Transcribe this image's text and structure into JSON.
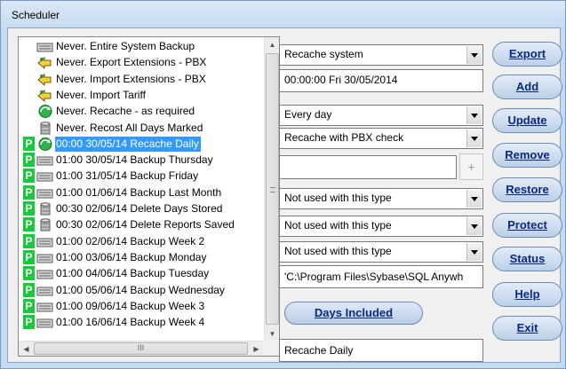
{
  "window": {
    "title": "Scheduler"
  },
  "list": {
    "items": [
      {
        "icon": "keyboard-icon",
        "p": false,
        "text": "Never.  Entire System Backup"
      },
      {
        "icon": "arrows-icon",
        "p": false,
        "text": "Never.  Export Extensions - PBX"
      },
      {
        "icon": "arrows-icon",
        "p": false,
        "text": "Never.  Import Extensions - PBX"
      },
      {
        "icon": "arrows-icon",
        "p": false,
        "text": "Never.  Import Tariff"
      },
      {
        "icon": "refresh-icon",
        "p": false,
        "text": "Never.  Recache - as required"
      },
      {
        "icon": "database-icon",
        "p": false,
        "text": "Never.  Recost All Days Marked"
      },
      {
        "icon": "refresh-icon",
        "p": true,
        "text": "00:00 30/05/14 Recache Daily",
        "selected": true
      },
      {
        "icon": "keyboard-icon",
        "p": true,
        "text": "01:00 30/05/14 Backup Thursday"
      },
      {
        "icon": "keyboard-icon",
        "p": true,
        "text": "01:00 31/05/14 Backup Friday"
      },
      {
        "icon": "keyboard-icon",
        "p": true,
        "text": "01:00 01/06/14 Backup Last Month"
      },
      {
        "icon": "database-icon",
        "p": true,
        "text": "00:30 02/06/14 Delete Days Stored"
      },
      {
        "icon": "database-icon",
        "p": true,
        "text": "00:30 02/06/14 Delete Reports Saved"
      },
      {
        "icon": "keyboard-icon",
        "p": true,
        "text": "01:00 02/06/14 Backup Week 2"
      },
      {
        "icon": "keyboard-icon",
        "p": true,
        "text": "01:00 03/06/14 Backup Monday"
      },
      {
        "icon": "keyboard-icon",
        "p": true,
        "text": "01:00 04/06/14 Backup Tuesday"
      },
      {
        "icon": "keyboard-icon",
        "p": true,
        "text": "01:00 05/06/14 Backup Wednesday"
      },
      {
        "icon": "keyboard-icon",
        "p": true,
        "text": "01:00 09/06/14 Backup Week 3"
      },
      {
        "icon": "keyboard-icon",
        "p": true,
        "text": "01:00 16/06/14 Backup Week 4"
      }
    ],
    "p_label": "P",
    "hscroll_grip": "III"
  },
  "form": {
    "task_type": "Recache system",
    "next_run": "00:00:00 Fri 30/05/2014",
    "frequency": "Every day",
    "option": "Recache with PBX check",
    "extra_value": "",
    "plus_label": "+",
    "param1": "Not used with this type",
    "param2": "Not used with this type",
    "param3": "Not used with this type",
    "path": "'C:\\Program Files\\Sybase\\SQL Anywh",
    "days_included": "Days Included",
    "task_name": "Recache Daily"
  },
  "buttons": {
    "export": "Export",
    "add": "Add",
    "update": "Update",
    "remove": "Remove",
    "restore": "Restore",
    "protect": "Protect",
    "status": "Status",
    "help": "Help",
    "exit": "Exit"
  }
}
